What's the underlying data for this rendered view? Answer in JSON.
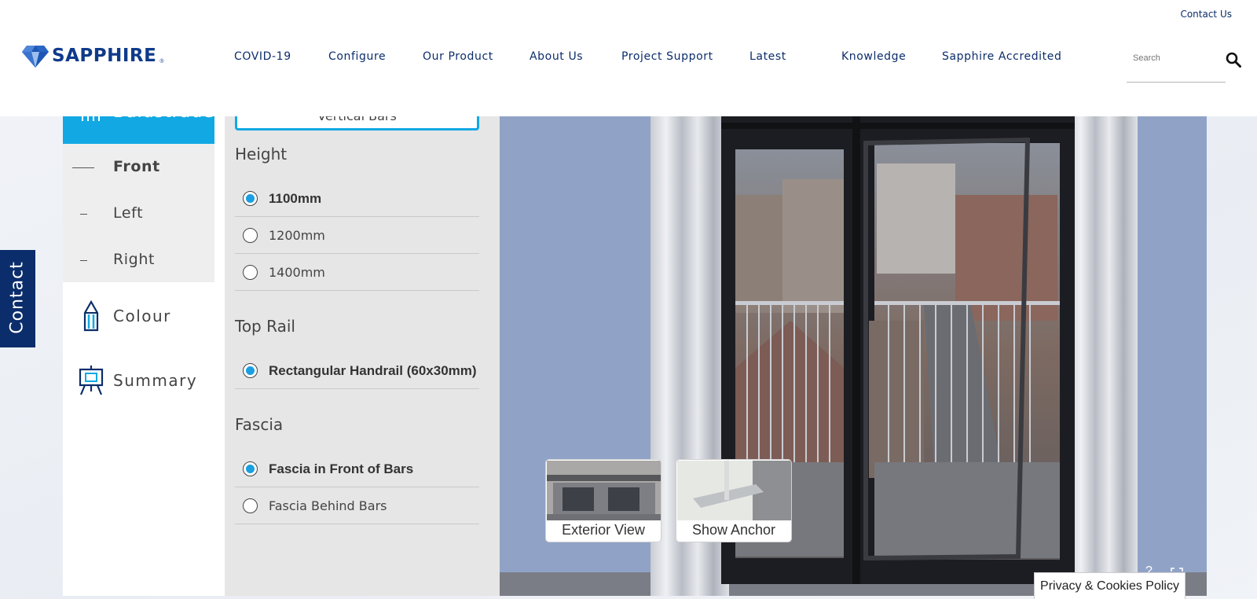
{
  "header": {
    "contact_us": "Contact Us",
    "logo_text": "SAPPHIRE",
    "logo_reg": "®",
    "nav": [
      "COVID-19",
      "Configure",
      "Our Product",
      "About Us",
      "Project Support",
      "Latest",
      "Knowledge",
      "Sapphire Accredited"
    ],
    "search_placeholder": "Search"
  },
  "sidebar": {
    "active_tab": "Balustrade",
    "sub_items": [
      "Front",
      "Left",
      "Right"
    ],
    "main_items": [
      {
        "label": "Colour",
        "icon": "pencil-icon"
      },
      {
        "label": "Summary",
        "icon": "easel-icon"
      }
    ]
  },
  "options": {
    "selected_bar_style": "Vertical Bars",
    "sections": [
      {
        "title": "Height",
        "options": [
          {
            "label": "1100mm",
            "checked": true
          },
          {
            "label": "1200mm",
            "checked": false
          },
          {
            "label": "1400mm",
            "checked": false
          }
        ]
      },
      {
        "title": "Top Rail",
        "options": [
          {
            "label": "Rectangular Handrail (60x30mm)",
            "checked": true
          }
        ]
      },
      {
        "title": "Fascia",
        "options": [
          {
            "label": "Fascia in Front of Bars",
            "checked": true
          },
          {
            "label": "Fascia Behind Bars",
            "checked": false
          }
        ]
      }
    ]
  },
  "viewer": {
    "buttons": [
      "Exterior View",
      "Show Anchor"
    ],
    "help_label": "?"
  },
  "contact_tab": "Contact",
  "privacy": "Privacy & Cookies Policy",
  "colors": {
    "brand_navy": "#0b2d6b",
    "accent_blue": "#12a8e3",
    "radio_blue": "#1a9fe0"
  }
}
